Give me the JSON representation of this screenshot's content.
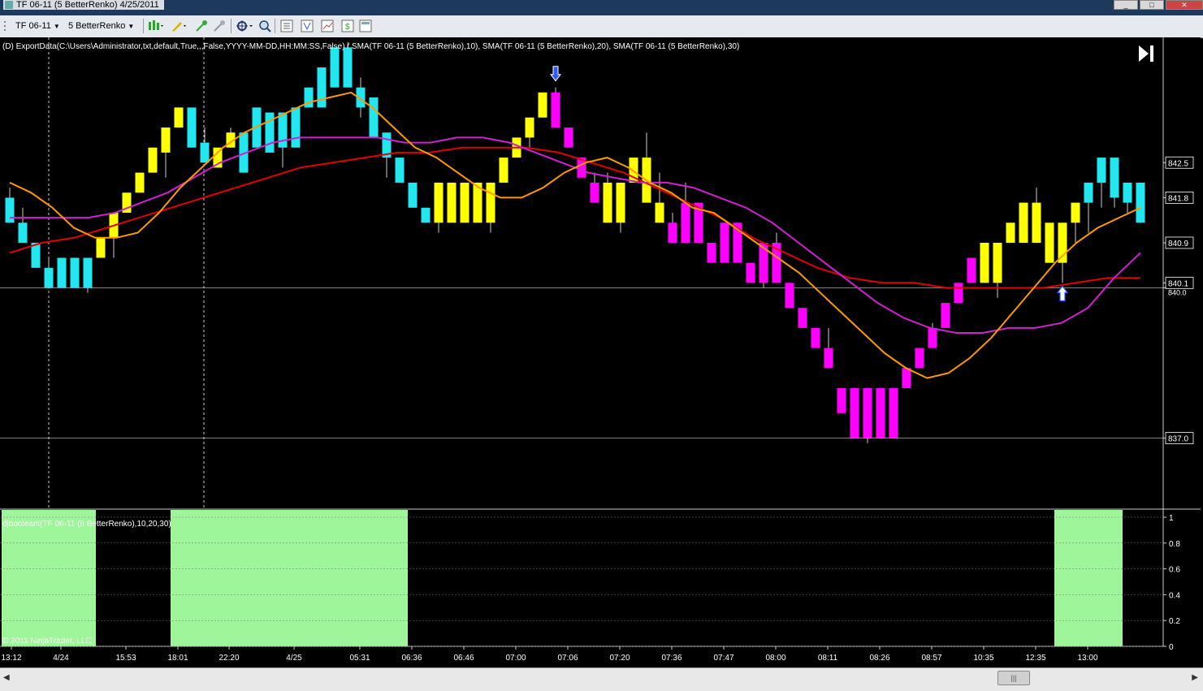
{
  "window": {
    "title": "TF 06-11 (5 BetterRenko)  4/25/2011",
    "buttons": [
      "_",
      "□",
      "✕"
    ]
  },
  "toolbar": {
    "instrument": "TF 06-11",
    "period": "5 BetterRenko"
  },
  "chart": {
    "caption": "(D) ExportData(C:\\Users\\Administrator,txt,default,True,,,False,YYYY-MM-DD,HH:MM:SS,False) / SMA(TF 06-11 (5 BetterRenko),10), SMA(TF 06-11 (5 BetterRenko),20), SMA(TF 06-11 (5 BetterRenko),30)",
    "subpanel_caption": "djbooleant(TF 06-11 (5 BetterRenko),10,20,30)",
    "copyright": "© 2011 NinjaTrader, LLC",
    "price_labels": [
      "842.5",
      "841.8",
      "840.9",
      "840.1",
      "840.0",
      "837.0"
    ],
    "sub_labels": [
      "1",
      "0.8",
      "0.6",
      "0.4",
      "0.2",
      "0"
    ],
    "time_labels": [
      "13:12",
      "4/24",
      "15:53",
      "18:01",
      "22:20",
      "4/25",
      "05:31",
      "06:36",
      "06:46",
      "07:00",
      "07:06",
      "07:20",
      "07:36",
      "07:47",
      "08:00",
      "08:11",
      "08:26",
      "08:57",
      "10:35",
      "12:35",
      "13:00"
    ],
    "colors": {
      "cyan": "#22e6f0",
      "yellow": "#ffff00",
      "magenta": "#ff00ff",
      "sma10": "#ff9900",
      "sma20": "#d020d0",
      "sma30": "#e00000",
      "sub_fill": "#9ef59a"
    }
  },
  "chart_data": {
    "type": "candlestick",
    "y_range": [
      835.6,
      845.0
    ],
    "candles": [
      {
        "o": 841.3,
        "c": 841.8,
        "h": 842.0,
        "l": 841.3,
        "color": "cyan"
      },
      {
        "o": 840.9,
        "c": 841.3,
        "h": 841.6,
        "l": 840.9,
        "color": "cyan"
      },
      {
        "o": 840.4,
        "c": 840.9,
        "h": 840.9,
        "l": 840.4,
        "color": "cyan"
      },
      {
        "o": 840.0,
        "c": 840.4,
        "h": 840.6,
        "l": 840.0,
        "color": "cyan"
      },
      {
        "o": 840.0,
        "c": 840.6,
        "h": 840.6,
        "l": 840.0,
        "color": "cyan"
      },
      {
        "o": 840.0,
        "c": 840.6,
        "h": 840.6,
        "l": 840.0,
        "color": "cyan"
      },
      {
        "o": 840.0,
        "c": 840.6,
        "h": 840.6,
        "l": 839.9,
        "color": "cyan"
      },
      {
        "o": 840.6,
        "c": 841.0,
        "h": 841.0,
        "l": 840.6,
        "color": "yellow"
      },
      {
        "o": 841.0,
        "c": 841.5,
        "h": 841.5,
        "l": 840.6,
        "color": "yellow"
      },
      {
        "o": 841.5,
        "c": 841.9,
        "h": 841.9,
        "l": 841.5,
        "color": "yellow"
      },
      {
        "o": 841.9,
        "c": 842.3,
        "h": 842.3,
        "l": 841.9,
        "color": "yellow"
      },
      {
        "o": 842.3,
        "c": 842.8,
        "h": 842.8,
        "l": 842.3,
        "color": "yellow"
      },
      {
        "o": 842.7,
        "c": 843.2,
        "h": 843.2,
        "l": 842.2,
        "color": "yellow"
      },
      {
        "o": 843.2,
        "c": 843.6,
        "h": 843.6,
        "l": 843.2,
        "color": "yellow"
      },
      {
        "o": 842.8,
        "c": 843.6,
        "h": 843.6,
        "l": 842.8,
        "color": "cyan"
      },
      {
        "o": 842.5,
        "c": 842.9,
        "h": 843.2,
        "l": 842.5,
        "color": "cyan"
      },
      {
        "o": 842.4,
        "c": 842.8,
        "h": 842.8,
        "l": 842.4,
        "color": "yellow"
      },
      {
        "o": 842.8,
        "c": 843.1,
        "h": 843.2,
        "l": 842.8,
        "color": "yellow"
      },
      {
        "o": 842.3,
        "c": 843.1,
        "h": 843.1,
        "l": 842.3,
        "color": "cyan"
      },
      {
        "o": 842.8,
        "c": 843.6,
        "h": 843.6,
        "l": 842.8,
        "color": "cyan"
      },
      {
        "o": 842.7,
        "c": 843.5,
        "h": 843.5,
        "l": 842.7,
        "color": "cyan"
      },
      {
        "o": 842.8,
        "c": 843.5,
        "h": 843.5,
        "l": 842.4,
        "color": "cyan"
      },
      {
        "o": 842.8,
        "c": 843.6,
        "h": 843.6,
        "l": 842.8,
        "color": "cyan"
      },
      {
        "o": 843.6,
        "c": 844.0,
        "h": 844.0,
        "l": 843.6,
        "color": "cyan"
      },
      {
        "o": 843.6,
        "c": 844.4,
        "h": 844.4,
        "l": 843.6,
        "color": "cyan"
      },
      {
        "o": 844.0,
        "c": 844.8,
        "h": 844.8,
        "l": 844.0,
        "color": "cyan"
      },
      {
        "o": 844.0,
        "c": 844.8,
        "h": 844.9,
        "l": 844.0,
        "color": "cyan"
      },
      {
        "o": 843.6,
        "c": 844.0,
        "h": 844.2,
        "l": 843.4,
        "color": "cyan"
      },
      {
        "o": 843.0,
        "c": 843.8,
        "h": 843.8,
        "l": 843.0,
        "color": "cyan"
      },
      {
        "o": 842.6,
        "c": 843.1,
        "h": 843.1,
        "l": 842.2,
        "color": "cyan"
      },
      {
        "o": 842.1,
        "c": 842.6,
        "h": 842.6,
        "l": 842.1,
        "color": "cyan"
      },
      {
        "o": 841.6,
        "c": 842.1,
        "h": 842.1,
        "l": 841.6,
        "color": "cyan"
      },
      {
        "o": 841.3,
        "c": 841.6,
        "h": 841.6,
        "l": 841.3,
        "color": "cyan"
      },
      {
        "o": 841.3,
        "c": 842.1,
        "h": 842.1,
        "l": 841.1,
        "color": "yellow"
      },
      {
        "o": 841.3,
        "c": 842.1,
        "h": 842.1,
        "l": 841.3,
        "color": "yellow"
      },
      {
        "o": 841.3,
        "c": 842.1,
        "h": 842.1,
        "l": 841.3,
        "color": "yellow"
      },
      {
        "o": 841.3,
        "c": 842.1,
        "h": 842.1,
        "l": 841.3,
        "color": "yellow"
      },
      {
        "o": 841.3,
        "c": 842.1,
        "h": 842.1,
        "l": 841.1,
        "color": "yellow"
      },
      {
        "o": 842.1,
        "c": 842.6,
        "h": 842.6,
        "l": 842.1,
        "color": "yellow"
      },
      {
        "o": 842.6,
        "c": 843.0,
        "h": 843.0,
        "l": 842.6,
        "color": "yellow"
      },
      {
        "o": 843.0,
        "c": 843.4,
        "h": 843.4,
        "l": 842.8,
        "color": "yellow"
      },
      {
        "o": 843.4,
        "c": 843.9,
        "h": 843.9,
        "l": 843.4,
        "color": "yellow"
      },
      {
        "o": 843.9,
        "c": 843.2,
        "h": 844.0,
        "l": 843.2,
        "color": "magenta"
      },
      {
        "o": 843.2,
        "c": 842.8,
        "h": 843.2,
        "l": 842.8,
        "color": "magenta"
      },
      {
        "o": 842.6,
        "c": 842.2,
        "h": 842.6,
        "l": 842.2,
        "color": "magenta"
      },
      {
        "o": 842.1,
        "c": 841.7,
        "h": 842.3,
        "l": 841.7,
        "color": "magenta"
      },
      {
        "o": 842.1,
        "c": 841.3,
        "h": 842.3,
        "l": 841.3,
        "color": "yellow"
      },
      {
        "o": 841.3,
        "c": 842.1,
        "h": 842.1,
        "l": 841.1,
        "color": "yellow"
      },
      {
        "o": 842.1,
        "c": 842.6,
        "h": 842.6,
        "l": 842.1,
        "color": "yellow"
      },
      {
        "o": 841.7,
        "c": 842.6,
        "h": 843.1,
        "l": 841.7,
        "color": "yellow"
      },
      {
        "o": 841.3,
        "c": 841.7,
        "h": 842.3,
        "l": 841.3,
        "color": "yellow"
      },
      {
        "o": 841.3,
        "c": 840.9,
        "h": 841.5,
        "l": 840.9,
        "color": "magenta"
      },
      {
        "o": 841.7,
        "c": 840.9,
        "h": 842.1,
        "l": 840.9,
        "color": "magenta"
      },
      {
        "o": 841.7,
        "c": 840.9,
        "h": 841.7,
        "l": 840.9,
        "color": "magenta"
      },
      {
        "o": 840.9,
        "c": 840.5,
        "h": 840.9,
        "l": 840.5,
        "color": "magenta"
      },
      {
        "o": 841.3,
        "c": 840.5,
        "h": 841.3,
        "l": 840.5,
        "color": "magenta"
      },
      {
        "o": 841.3,
        "c": 840.5,
        "h": 841.3,
        "l": 840.5,
        "color": "magenta"
      },
      {
        "o": 840.5,
        "c": 840.1,
        "h": 840.5,
        "l": 840.1,
        "color": "magenta"
      },
      {
        "o": 840.9,
        "c": 840.1,
        "h": 840.9,
        "l": 840.0,
        "color": "magenta"
      },
      {
        "o": 840.9,
        "c": 840.1,
        "h": 841.1,
        "l": 840.1,
        "color": "magenta"
      },
      {
        "o": 840.1,
        "c": 839.6,
        "h": 840.1,
        "l": 839.6,
        "color": "magenta"
      },
      {
        "o": 839.6,
        "c": 839.2,
        "h": 839.6,
        "l": 839.2,
        "color": "magenta"
      },
      {
        "o": 839.2,
        "c": 838.8,
        "h": 839.2,
        "l": 838.8,
        "color": "magenta"
      },
      {
        "o": 838.8,
        "c": 838.4,
        "h": 839.2,
        "l": 838.4,
        "color": "magenta"
      },
      {
        "o": 838.0,
        "c": 837.5,
        "h": 838.0,
        "l": 837.5,
        "color": "magenta"
      },
      {
        "o": 838.0,
        "c": 837.0,
        "h": 838.0,
        "l": 837.0,
        "color": "magenta"
      },
      {
        "o": 838.0,
        "c": 837.0,
        "h": 838.0,
        "l": 836.9,
        "color": "magenta"
      },
      {
        "o": 838.0,
        "c": 837.0,
        "h": 838.0,
        "l": 837.0,
        "color": "magenta"
      },
      {
        "o": 838.0,
        "c": 837.0,
        "h": 838.0,
        "l": 837.0,
        "color": "magenta"
      },
      {
        "o": 838.0,
        "c": 838.4,
        "h": 838.4,
        "l": 838.0,
        "color": "magenta"
      },
      {
        "o": 838.4,
        "c": 838.8,
        "h": 838.8,
        "l": 838.4,
        "color": "magenta"
      },
      {
        "o": 838.8,
        "c": 839.2,
        "h": 839.3,
        "l": 838.8,
        "color": "magenta"
      },
      {
        "o": 839.2,
        "c": 839.7,
        "h": 839.7,
        "l": 839.2,
        "color": "magenta"
      },
      {
        "o": 839.7,
        "c": 840.1,
        "h": 840.1,
        "l": 839.7,
        "color": "magenta"
      },
      {
        "o": 840.1,
        "c": 840.6,
        "h": 840.6,
        "l": 840.1,
        "color": "magenta"
      },
      {
        "o": 840.1,
        "c": 840.9,
        "h": 840.9,
        "l": 840.1,
        "color": "yellow"
      },
      {
        "o": 840.1,
        "c": 840.9,
        "h": 840.9,
        "l": 839.8,
        "color": "yellow"
      },
      {
        "o": 840.9,
        "c": 841.3,
        "h": 841.3,
        "l": 840.9,
        "color": "yellow"
      },
      {
        "o": 840.9,
        "c": 841.7,
        "h": 841.7,
        "l": 840.9,
        "color": "yellow"
      },
      {
        "o": 840.9,
        "c": 841.7,
        "h": 842.0,
        "l": 840.9,
        "color": "yellow"
      },
      {
        "o": 840.5,
        "c": 841.3,
        "h": 841.3,
        "l": 840.5,
        "color": "yellow"
      },
      {
        "o": 840.5,
        "c": 841.3,
        "h": 841.3,
        "l": 840.1,
        "color": "yellow"
      },
      {
        "o": 841.3,
        "c": 841.7,
        "h": 841.7,
        "l": 840.9,
        "color": "yellow"
      },
      {
        "o": 841.7,
        "c": 842.1,
        "h": 842.1,
        "l": 841.1,
        "color": "cyan"
      },
      {
        "o": 842.1,
        "c": 842.6,
        "h": 842.6,
        "l": 841.6,
        "color": "cyan"
      },
      {
        "o": 841.8,
        "c": 842.6,
        "h": 842.6,
        "l": 841.6,
        "color": "cyan"
      },
      {
        "o": 841.7,
        "c": 842.1,
        "h": 842.1,
        "l": 841.5,
        "color": "cyan"
      },
      {
        "o": 841.3,
        "c": 842.1,
        "h": 842.1,
        "l": 841.3,
        "color": "cyan"
      }
    ],
    "sma10": [
      842.1,
      841.9,
      841.6,
      841.2,
      841.0,
      841.0,
      841.1,
      841.5,
      842.0,
      842.4,
      842.8,
      843.1,
      843.3,
      843.5,
      843.7,
      843.8,
      843.9,
      843.6,
      843.2,
      842.8,
      842.6,
      842.3,
      842.0,
      841.8,
      841.8,
      842.0,
      842.3,
      842.5,
      842.6,
      842.4,
      842.1,
      841.9,
      841.6,
      841.5,
      841.2,
      840.9,
      840.6,
      840.3,
      839.9,
      839.5,
      839.1,
      838.7,
      838.4,
      838.2,
      838.3,
      838.6,
      839.0,
      839.5,
      840.0,
      840.5,
      840.9,
      841.2,
      841.4,
      841.6
    ],
    "sma20": [
      841.4,
      841.4,
      841.4,
      841.4,
      841.5,
      841.7,
      841.9,
      842.2,
      842.5,
      842.7,
      842.9,
      843.0,
      843.0,
      843.0,
      843.0,
      842.9,
      842.9,
      843.0,
      843.0,
      842.9,
      842.7,
      842.5,
      842.3,
      842.2,
      842.1,
      842.1,
      842.0,
      841.8,
      841.6,
      841.3,
      840.9,
      840.5,
      840.1,
      839.7,
      839.4,
      839.2,
      839.1,
      839.1,
      839.2,
      839.2,
      839.3,
      839.6,
      840.2,
      840.7
    ],
    "sma30": [
      840.7,
      840.9,
      841.0,
      841.2,
      841.4,
      841.6,
      841.8,
      842.0,
      842.2,
      842.4,
      842.5,
      842.6,
      842.7,
      842.7,
      842.8,
      842.8,
      842.8,
      842.7,
      842.5,
      842.3,
      842.0,
      841.7,
      841.4,
      841.0,
      840.7,
      840.4,
      840.2,
      840.1,
      840.1,
      840.0,
      840.0,
      840.0,
      840.0,
      840.1,
      840.2,
      840.2
    ],
    "markers": [
      {
        "type": "down-arrow",
        "candle": 42,
        "color": "#ffffff"
      },
      {
        "type": "up-arrow",
        "candle": 81,
        "color": "#2a5cff"
      }
    ],
    "sub_panel": {
      "type": "boolean-area",
      "y_range": [
        0,
        1
      ],
      "on_segments": [
        [
          0,
          6
        ],
        [
          13,
          30
        ],
        [
          81,
          85
        ]
      ]
    }
  }
}
